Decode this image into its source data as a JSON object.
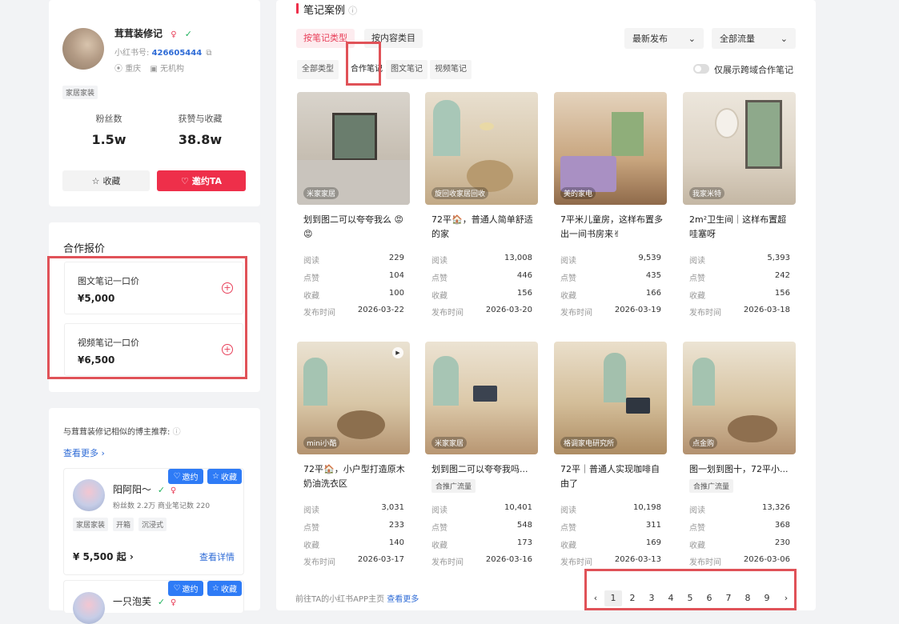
{
  "profile": {
    "name": "茸茸装修记",
    "id_label": "小红书号:",
    "id_value": "426605444",
    "location": "重庆",
    "org": "无机构",
    "tag": "家居家装",
    "stats": [
      {
        "label": "粉丝数",
        "value": "1.5w"
      },
      {
        "label": "获赞与收藏",
        "value": "38.8w"
      }
    ],
    "fav_label": "收藏",
    "invite_label": "邀约TA"
  },
  "quotes": {
    "title": "合作报价",
    "items": [
      {
        "label": "图文笔记一口价",
        "price": "¥5,000"
      },
      {
        "label": "视频笔记一口价",
        "price": "¥6,500"
      }
    ]
  },
  "recommend": {
    "title": "与茸茸装修记相似的博主推荐:",
    "more": "查看更多",
    "items": [
      {
        "name": "阳阿阳～",
        "meta": "粉丝数 2.2万   商业笔记数 220",
        "tags": [
          "家居家装",
          "开箱",
          "沉浸式"
        ],
        "price": "¥ 5,500 起",
        "detail": "查看详情",
        "invite": "邀约",
        "fav": "收藏"
      },
      {
        "name": "一只泡芙",
        "invite": "邀约",
        "fav": "收藏"
      }
    ]
  },
  "notes": {
    "title": "笔记案例",
    "tabs": [
      "按笔记类型",
      "按内容类目"
    ],
    "sort": "最新发布",
    "traffic": "全部流量",
    "filters": [
      "全部类型",
      "合作笔记",
      "图文笔记",
      "视频笔记"
    ],
    "toggle_label": "仅展示跨域合作笔记",
    "stat_labels": [
      "阅读",
      "点赞",
      "收藏",
      "发布时间"
    ],
    "items": [
      {
        "title": "划到图二可以夸夸我么 😡😡",
        "badge": "米家家居",
        "read": "229",
        "like": "104",
        "fav": "100",
        "date": "2026-03-22",
        "tag": ""
      },
      {
        "title": "72平🏠，普通人简单舒适的家",
        "badge": "旋回收家居回收",
        "read": "13,008",
        "like": "446",
        "fav": "156",
        "date": "2026-03-20",
        "tag": ""
      },
      {
        "title": "7平米儿童房，这样布置多出一间书房来✌",
        "badge": "美的家电",
        "read": "9,539",
        "like": "435",
        "fav": "166",
        "date": "2026-03-19",
        "tag": ""
      },
      {
        "title": "2m²卫生间｜这样布置超哇塞呀",
        "badge": "我家米特",
        "read": "5,393",
        "like": "242",
        "fav": "156",
        "date": "2026-03-18",
        "tag": ""
      },
      {
        "title": "72平🏠，小户型打造原木奶油洗衣区",
        "badge": "mini小酷",
        "read": "3,031",
        "like": "233",
        "fav": "140",
        "date": "2026-03-17",
        "tag": ""
      },
      {
        "title": "划到图二可以夸夸我吗...",
        "badge": "米家家居",
        "read": "10,401",
        "like": "548",
        "fav": "173",
        "date": "2026-03-16",
        "tag": "合推广流量"
      },
      {
        "title": "72平｜普通人实现咖啡自由了",
        "badge": "格调家电研究所",
        "read": "10,198",
        "like": "311",
        "fav": "169",
        "date": "2026-03-13",
        "tag": ""
      },
      {
        "title": "图一划到图十，72平小...",
        "badge": "点金购",
        "read": "13,326",
        "like": "368",
        "fav": "230",
        "date": "2026-03-06",
        "tag": "合推广流量"
      }
    ],
    "footer_text": "前往TA的小红书APP主页",
    "footer_link": "查看更多",
    "pages": [
      "1",
      "2",
      "3",
      "4",
      "5",
      "6",
      "7",
      "8",
      "9"
    ]
  }
}
